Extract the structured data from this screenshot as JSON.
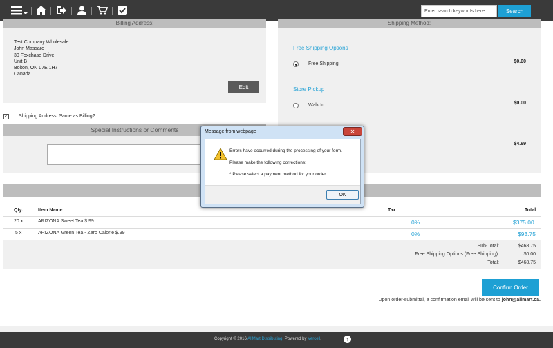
{
  "topbar": {
    "search_placeholder": "Enter search keywords here",
    "search_button": "Search"
  },
  "billing": {
    "header": "Billing Address:",
    "address_lines": [
      "Test Company Wholesale",
      "John Massaro",
      "30 Foxchase Drive",
      "Unit B",
      "Bolton, ON L7E 1H7",
      "Canada"
    ],
    "edit_button": "Edit"
  },
  "shipping": {
    "header": "Shipping Method:",
    "groups": [
      {
        "title": "Free Shipping Options",
        "option": "Free Shipping",
        "price": "$0.00",
        "selected": true
      },
      {
        "title": "Store Pickup",
        "option": "Walk In",
        "price": "$0.00",
        "selected": false
      }
    ],
    "hidden_price": "$4.69"
  },
  "same_as_billing_label": "Shipping Address, Same as Billing?",
  "instructions_header": "Special Instructions or Comments",
  "order": {
    "columns": {
      "qty": "Qty.",
      "item": "Item Name",
      "tax": "Tax",
      "total": "Total"
    },
    "rows": [
      {
        "qty": "20 x",
        "item": "ARIZONA Sweet Tea $.99",
        "tax": "0%",
        "total": "$375.00"
      },
      {
        "qty": "5 x",
        "item": "ARIZONA Green Tea - Zero Calorie $.99",
        "tax": "0%",
        "total": "$93.75"
      }
    ],
    "totals": [
      {
        "label": "Sub-Total:",
        "value": "$468.75"
      },
      {
        "label": "Free Shipping Options (Free Shipping):",
        "value": "$0.00"
      },
      {
        "label": "Total:",
        "value": "$468.75"
      }
    ],
    "confirm_button": "Confirm Order",
    "note_prefix": "Upon order-submittal, a confirmation email will be sent to",
    "note_email": "john@allmart.ca."
  },
  "footer": {
    "copyright": "Copyright © 2016",
    "company": "AllMart Distributing",
    "powered": ". Powered by",
    "vendor": "Vercell",
    "period": "."
  },
  "dialog": {
    "title": "Message from webpage",
    "close": "✕",
    "line1": "Errors have occurred during the processing of your form.",
    "line2": "Please make the following corrections:",
    "line3": "* Please select a payment method for your order.",
    "ok_button": "OK"
  },
  "colors": {
    "accent": "#1ea0d4",
    "header_bar": "#3a3a3a",
    "link_blue": "#2aa4d6"
  }
}
